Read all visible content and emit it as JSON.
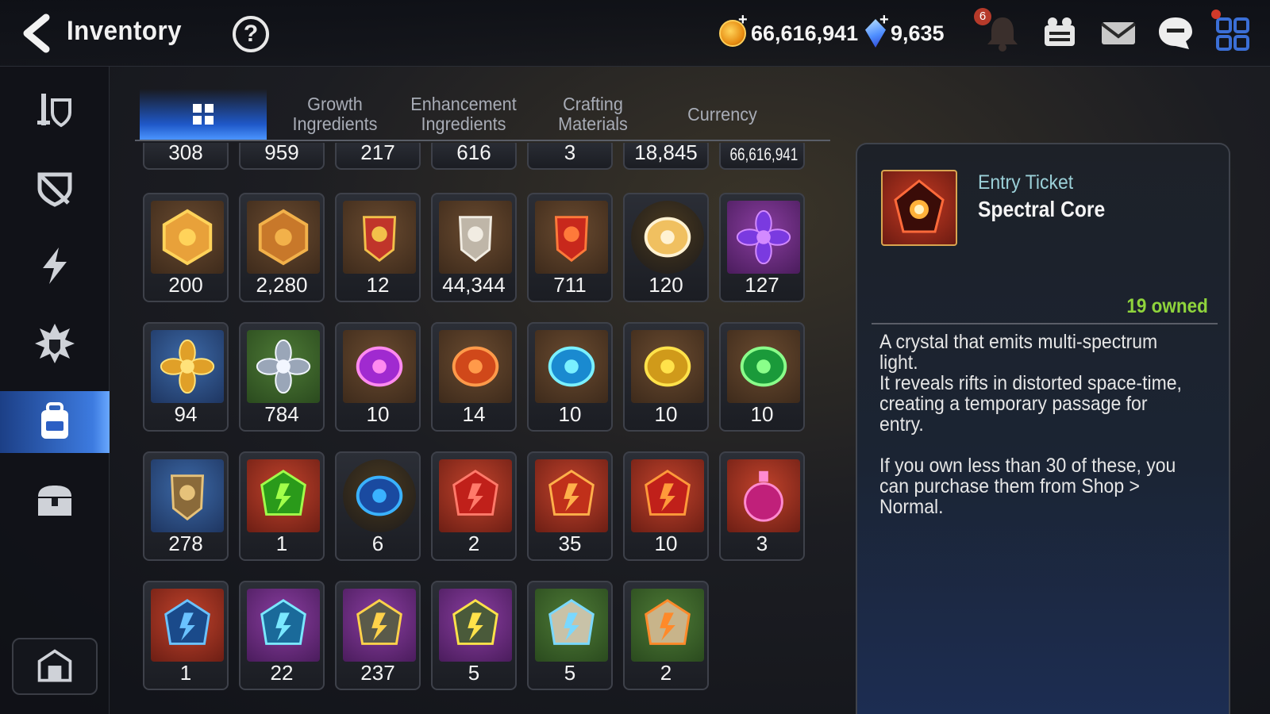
{
  "header": {
    "title": "Inventory",
    "help_label": "?",
    "gold": "66,616,941",
    "crystals": "9,635",
    "plus_label": "+",
    "notification_count": "6"
  },
  "sidebar": {
    "items": [
      {
        "icon": "weapon-armor-icon"
      },
      {
        "icon": "broken-shield-icon"
      },
      {
        "icon": "lightning-icon"
      },
      {
        "icon": "spiked-emblem-icon"
      },
      {
        "icon": "backpack-icon",
        "active": true
      },
      {
        "icon": "chest-icon"
      }
    ],
    "bottom_icon": "storage-icon"
  },
  "tabs": [
    {
      "label": "",
      "active": true
    },
    {
      "label": "Growth\nIngredients"
    },
    {
      "label": "Enhancement\nIngredients"
    },
    {
      "label": "Crafting\nMaterials"
    },
    {
      "label": "Currency"
    }
  ],
  "grid": {
    "top_row": [
      "308",
      "959",
      "217",
      "616",
      "3",
      "18,845",
      "66,616,941"
    ],
    "rows": [
      [
        {
          "count": "200",
          "bg": "brown",
          "icon": "gold-emblem-icon"
        },
        {
          "count": "2,280",
          "bg": "brown",
          "icon": "fist-emblem-icon"
        },
        {
          "count": "12",
          "bg": "brown",
          "icon": "banner-icon"
        },
        {
          "count": "44,344",
          "bg": "brown",
          "icon": "horse-statue-icon"
        },
        {
          "count": "711",
          "bg": "brown",
          "icon": "red-leaf-icon"
        },
        {
          "count": "120",
          "bg": "circle",
          "icon": "mascot-portrait-icon"
        },
        {
          "count": "127",
          "bg": "purple",
          "icon": "purple-flower-icon"
        }
      ],
      [
        {
          "count": "94",
          "bg": "blue",
          "icon": "gold-flower-icon"
        },
        {
          "count": "784",
          "bg": "green",
          "icon": "silver-flower-icon"
        },
        {
          "count": "10",
          "bg": "brown",
          "icon": "purple-rune-icon"
        },
        {
          "count": "14",
          "bg": "brown",
          "icon": "orange-rune-icon"
        },
        {
          "count": "10",
          "bg": "brown",
          "icon": "cyan-rune-icon"
        },
        {
          "count": "10",
          "bg": "brown",
          "icon": "yellow-rune-icon"
        },
        {
          "count": "10",
          "bg": "brown",
          "icon": "green-rune-icon"
        }
      ],
      [
        {
          "count": "278",
          "bg": "blue",
          "icon": "root-herb-icon"
        },
        {
          "count": "1",
          "bg": "red",
          "icon": "green-crystal-icon"
        },
        {
          "count": "6",
          "bg": "circle",
          "icon": "blue-portal-icon"
        },
        {
          "count": "2",
          "bg": "red",
          "icon": "red-star-gem-icon"
        },
        {
          "count": "35",
          "bg": "red",
          "icon": "red-hammer-gem-icon"
        },
        {
          "count": "10",
          "bg": "red",
          "icon": "red-bolt-gem-icon"
        },
        {
          "count": "3",
          "bg": "red",
          "icon": "pink-potion-icon"
        }
      ],
      [
        {
          "count": "1",
          "bg": "red",
          "icon": "blue-stone-icon"
        },
        {
          "count": "22",
          "bg": "purple",
          "icon": "blue-star-gem-icon"
        },
        {
          "count": "237",
          "bg": "purple",
          "icon": "gold-hammer-stone-icon"
        },
        {
          "count": "5",
          "bg": "purple",
          "icon": "bolt-stone-icon"
        },
        {
          "count": "5",
          "bg": "green",
          "icon": "white-star-gem-icon"
        },
        {
          "count": "2",
          "bg": "green",
          "icon": "orange-hammer-stone-icon"
        }
      ]
    ]
  },
  "detail": {
    "category": "Entry Ticket",
    "name": "Spectral Core",
    "owned": "19 owned",
    "description": "A crystal that emits multi-spectrum\nlight.\nIt reveals rifts in distorted space-time,\ncreating a temporary passage for entry.\n\nIf you own less than 30 of these, you\ncan purchase them from Shop > Normal."
  },
  "colors": {
    "accent_blue": "#3d7be0",
    "owned_green": "#8fd43c",
    "category_teal": "#9bd0d8"
  }
}
